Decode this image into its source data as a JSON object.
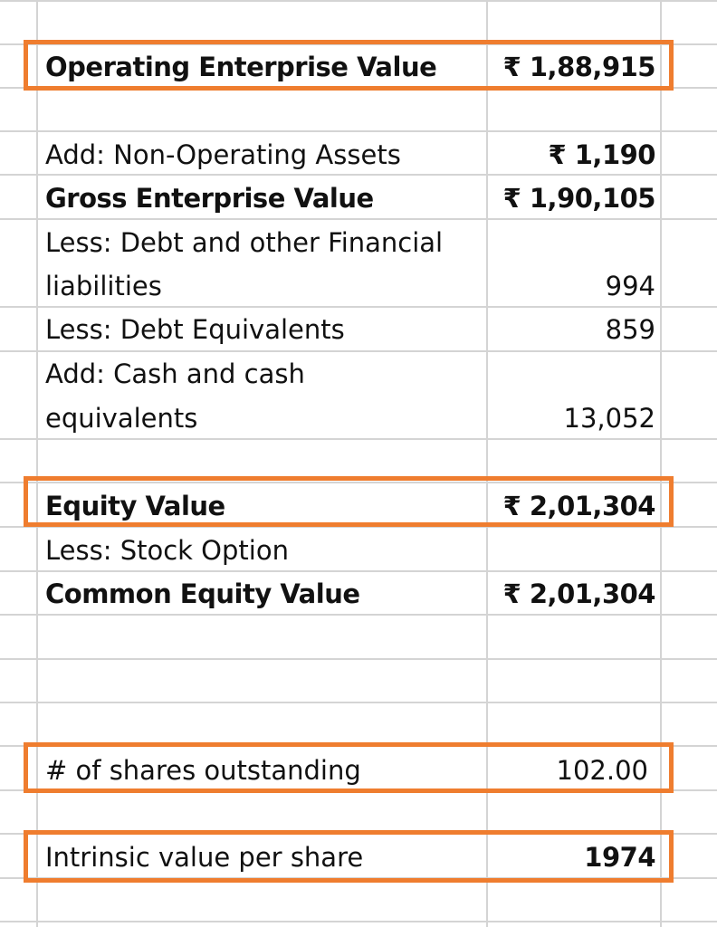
{
  "sheet": {
    "rows": [
      {
        "label": "Operating Enterprise Value",
        "value": "₹ 1,88,915",
        "bold_label": true,
        "bold_value": true
      },
      {
        "label": "Add: Non-Operating Assets",
        "value": "₹ 1,190",
        "bold_label": false,
        "bold_value": true
      },
      {
        "label": "Gross Enterprise Value",
        "value": "₹ 1,90,105",
        "bold_label": true,
        "bold_value": true
      },
      {
        "label_line1": "Less: Debt and other Financial",
        "label_line2": "liabilities",
        "value": "994"
      },
      {
        "label": "Less: Debt Equivalents",
        "value": "859"
      },
      {
        "label_line1": "Add: Cash and cash",
        "label_line2": "equivalents",
        "value": "13,052"
      },
      {
        "label": "Equity Value",
        "value": "₹ 2,01,304",
        "bold_label": true,
        "bold_value": true
      },
      {
        "label": "Less: Stock Option",
        "value": ""
      },
      {
        "label": "Common Equity Value",
        "value": "₹ 2,01,304",
        "bold_label": true,
        "bold_value": true
      },
      {
        "label": "# of shares outstanding",
        "value": "102.00"
      },
      {
        "label": "Intrinsic value per share",
        "value": "1974",
        "bold_value": true
      }
    ]
  },
  "highlight_color": "#ef7d2f",
  "grid_color": "#d4d4d4"
}
